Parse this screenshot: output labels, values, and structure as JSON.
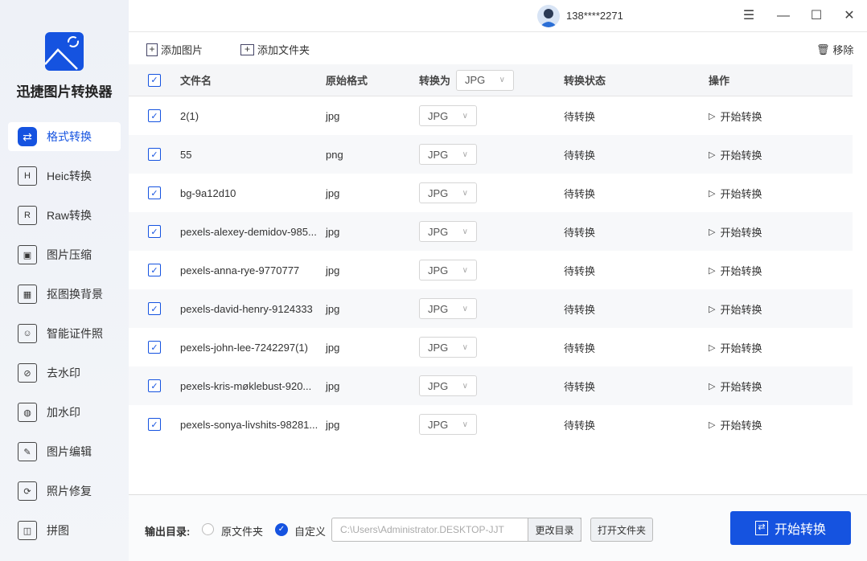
{
  "app": {
    "name": "迅捷图片转换器"
  },
  "sidebar": {
    "items": [
      {
        "label": "格式转换",
        "icon": "convert-icon"
      },
      {
        "label": "Heic转换",
        "icon": "heic-icon"
      },
      {
        "label": "Raw转换",
        "icon": "raw-icon"
      },
      {
        "label": "图片压缩",
        "icon": "image-compress-icon"
      },
      {
        "label": "抠图换背景",
        "icon": "cutout-icon"
      },
      {
        "label": "智能证件照",
        "icon": "id-photo-icon"
      },
      {
        "label": "去水印",
        "icon": "remove-watermark-icon"
      },
      {
        "label": "加水印",
        "icon": "add-watermark-icon"
      },
      {
        "label": "图片编辑",
        "icon": "image-edit-icon"
      },
      {
        "label": "照片修复",
        "icon": "photo-repair-icon"
      },
      {
        "label": "拼图",
        "icon": "collage-icon"
      }
    ]
  },
  "user": {
    "phone": "138****2271"
  },
  "toolbar": {
    "add_image": "添加图片",
    "add_folder": "添加文件夹",
    "remove": "移除"
  },
  "table": {
    "headers": {
      "filename": "文件名",
      "orig_format": "原始格式",
      "convert_to": "转换为",
      "convert_to_value": "JPG",
      "status": "转换状态",
      "action": "操作"
    },
    "rows": [
      {
        "name": "2(1)",
        "format": "jpg",
        "target": "JPG",
        "status": "待转换",
        "action": "开始转换"
      },
      {
        "name": "55",
        "format": "png",
        "target": "JPG",
        "status": "待转换",
        "action": "开始转换"
      },
      {
        "name": "bg-9a12d10",
        "format": "jpg",
        "target": "JPG",
        "status": "待转换",
        "action": "开始转换"
      },
      {
        "name": "pexels-alexey-demidov-985...",
        "format": "jpg",
        "target": "JPG",
        "status": "待转换",
        "action": "开始转换"
      },
      {
        "name": "pexels-anna-rye-9770777",
        "format": "jpg",
        "target": "JPG",
        "status": "待转换",
        "action": "开始转换"
      },
      {
        "name": "pexels-david-henry-9124333",
        "format": "jpg",
        "target": "JPG",
        "status": "待转换",
        "action": "开始转换"
      },
      {
        "name": "pexels-john-lee-7242297(1)",
        "format": "jpg",
        "target": "JPG",
        "status": "待转换",
        "action": "开始转换"
      },
      {
        "name": "pexels-kris-møklebust-920...",
        "format": "jpg",
        "target": "JPG",
        "status": "待转换",
        "action": "开始转换"
      },
      {
        "name": "pexels-sonya-livshits-98281...",
        "format": "jpg",
        "target": "JPG",
        "status": "待转换",
        "action": "开始转换"
      }
    ]
  },
  "bottom": {
    "output_label": "输出目录:",
    "opt_original": "原文件夹",
    "opt_custom": "自定义",
    "path": "C:\\Users\\Administrator.DESKTOP-JJT",
    "change_dir": "更改目录",
    "open_folder": "打开文件夹",
    "start": "开始转换"
  },
  "colors": {
    "accent": "#1553e0"
  }
}
